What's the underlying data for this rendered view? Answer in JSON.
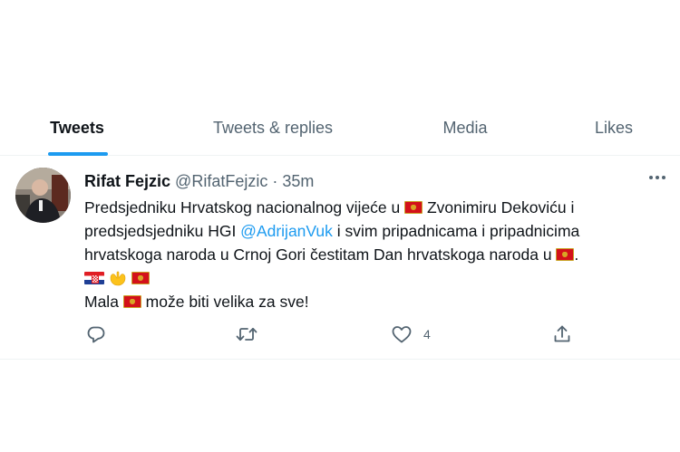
{
  "tabs": [
    {
      "label": "Tweets",
      "active": true
    },
    {
      "label": "Tweets & replies",
      "active": false
    },
    {
      "label": "Media",
      "active": false
    },
    {
      "label": "Likes",
      "active": false
    }
  ],
  "tweet": {
    "name": "Rifat Fejzic",
    "handle": "@RifatFejzic",
    "separator": "·",
    "time": "35m",
    "lines": {
      "l1a": "Predsjedniku Hrvatskog nacionalnog vijeće u ",
      "l1b": " Zvonimiru Dekoviću i",
      "l2a": "predsjedsjedniku HGI  ",
      "l2mention": "@AdrijanVuk",
      "l2b": " i  svim pripadnicama i pripadnicima",
      "l3a": "hrvatskoga naroda u Crnoj Gori čestitam  Dan hrvatskoga naroda u ",
      "l3b": ".",
      "l5a": "Mala ",
      "l5b": " može biti velika za sve!"
    },
    "emoji": [
      "flag-montenegro",
      "flag-croatia",
      "raising-hands"
    ],
    "stats": {
      "reply": "",
      "retweet": "",
      "like": "4"
    }
  },
  "icons": {
    "more": "more-horizontal-icon",
    "reply": "reply-icon",
    "retweet": "retweet-icon",
    "like": "heart-icon",
    "share": "share-icon"
  },
  "colors": {
    "accent": "#1d9bf0",
    "muted": "#536471",
    "text": "#0f1419",
    "border": "#eff3f4"
  }
}
